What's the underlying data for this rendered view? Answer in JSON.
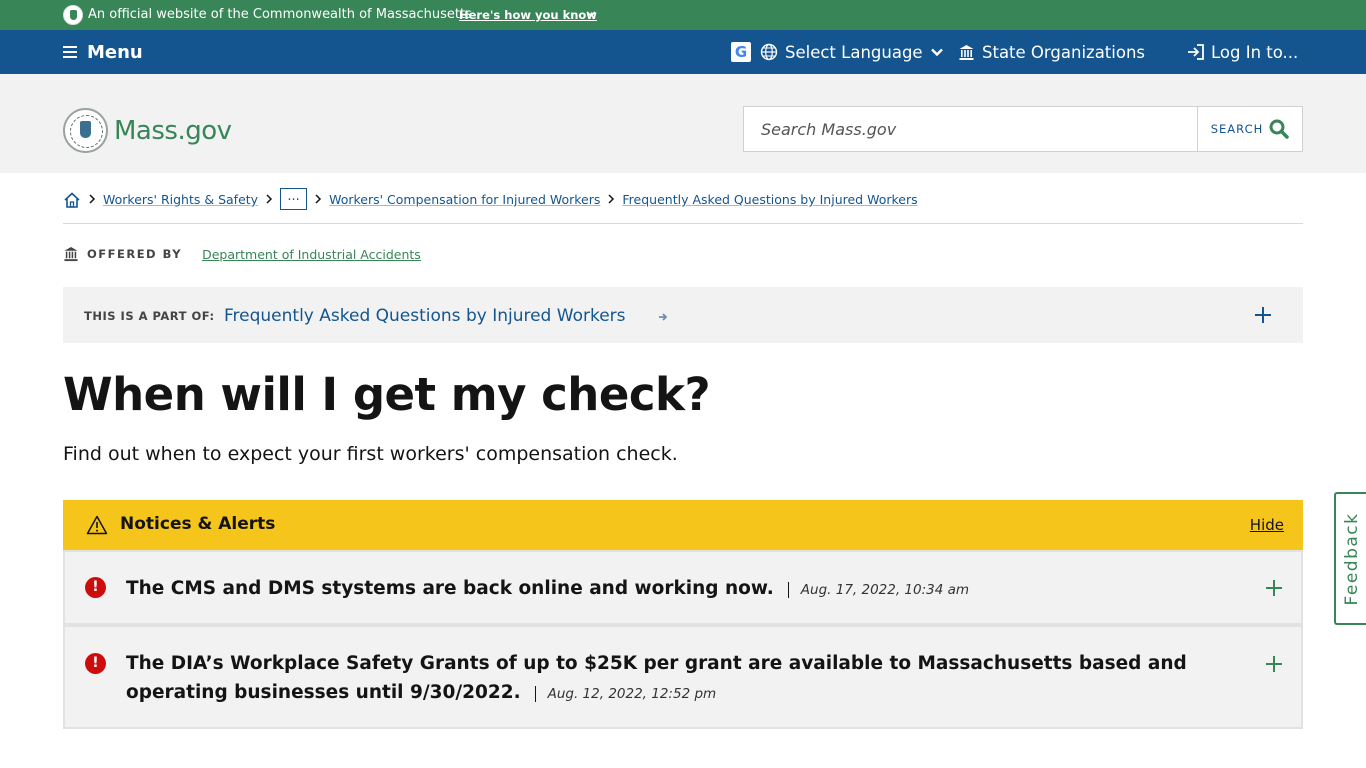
{
  "official_banner": {
    "text": "An official website of the Commonwealth of Massachusetts",
    "link": "Here's how you know"
  },
  "utility_nav": {
    "menu": "Menu",
    "google_glyph": "G",
    "language": "Select Language",
    "state_orgs": "State Organizations",
    "login": "Log In to..."
  },
  "header": {
    "logo": "Mass.gov",
    "search_placeholder": "Search Mass.gov",
    "search_button": "SEARCH"
  },
  "breadcrumbs": {
    "items": [
      "Workers' Rights & Safety",
      "...",
      "Workers' Compensation for Injured Workers",
      "Frequently Asked Questions by Injured Workers"
    ]
  },
  "offered_by": {
    "label": "OFFERED BY",
    "org": "Department of Industrial Accidents"
  },
  "part_of": {
    "label": "THIS IS A PART OF:",
    "link": "Frequently Asked Questions by Injured Workers"
  },
  "page": {
    "title": "When will I get my check?",
    "lede": "Find out when to expect your first workers' compensation check."
  },
  "alerts": {
    "title": "Notices & Alerts",
    "hide": "Hide",
    "alert_glyph": "!",
    "items": [
      {
        "text": "The CMS and DMS stystems are back online and working now.",
        "date": "Aug. 17, 2022, 10:34 am"
      },
      {
        "text": "The DIA’s Workplace Safety Grants of up to $25K per grant are available to Massachusetts based and operating businesses until 9/30/2022.",
        "date": "Aug. 12, 2022, 12:52 pm"
      }
    ]
  },
  "feedback": "Feedback",
  "colors": {
    "green": "#388557",
    "blue": "#14558f",
    "alert_yellow": "#f6c51b",
    "alert_red": "#cd0d0d"
  }
}
